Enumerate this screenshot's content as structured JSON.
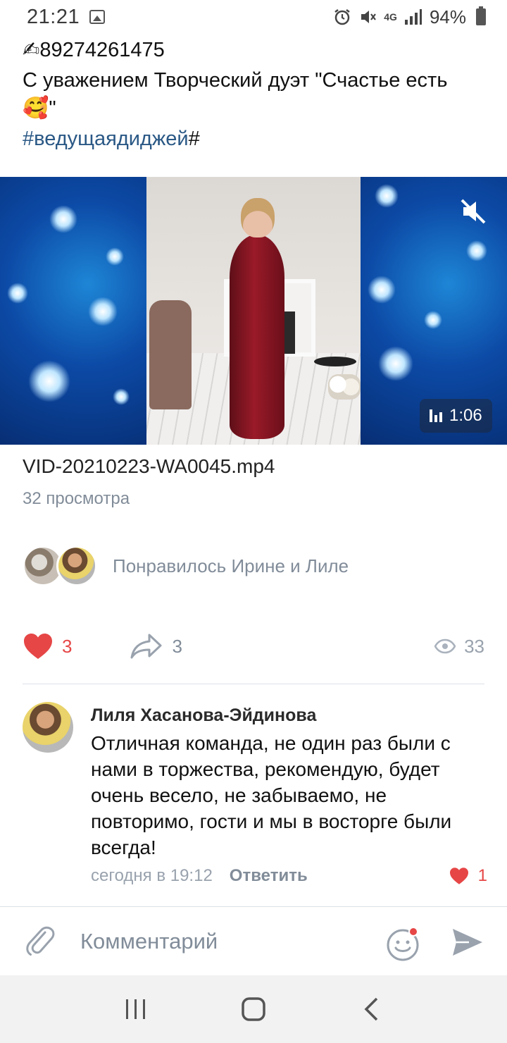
{
  "status_bar": {
    "time": "21:21",
    "network": "4G",
    "battery": "94%"
  },
  "post": {
    "phone": "89274261475",
    "signature": "С уважением Творческий дуэт \"Счастье есть",
    "signature_end": "\"",
    "hashtag": "#ведущаядиджей",
    "hashtag_suffix": "#"
  },
  "video": {
    "duration": "1:06",
    "file_name": "VID-20210223-WA0045.mp4",
    "views": "32 просмотра"
  },
  "likes": {
    "text": "Понравилось Ирине и Лиле"
  },
  "actions": {
    "likes": "3",
    "shares": "3",
    "views": "33"
  },
  "comment": {
    "author": "Лиля Хасанова-Эйдинова",
    "text": "Отличная команда, не один раз были с нами в торжества, рекомендую, будет очень весело, не забываемо, не повторимо, гости и мы в восторге были всегда!",
    "time": "сегодня в 19:12",
    "reply": "Ответить",
    "likes": "1"
  },
  "composer": {
    "placeholder": "Комментарий"
  },
  "colors": {
    "accent": "#2a5885",
    "like": "#e64646",
    "muted": "#818c99"
  }
}
